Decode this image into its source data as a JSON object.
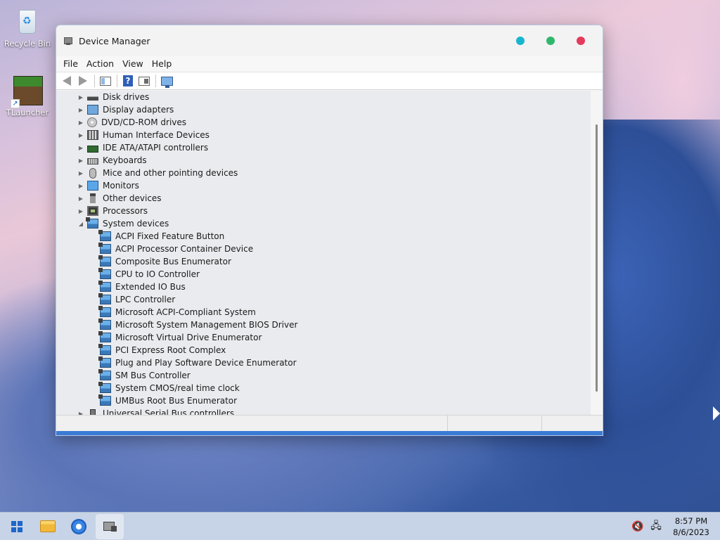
{
  "desktop": {
    "icons": [
      {
        "label": "Recycle Bin",
        "icon": "recycle-bin-icon"
      },
      {
        "label": "TLauncher",
        "icon": "tlauncher-icon"
      }
    ]
  },
  "window": {
    "title": "Device Manager",
    "controls": {
      "minimize_color": "#18b5cf",
      "maximize_color": "#2fb86c",
      "close_color": "#e53a5b"
    },
    "menu": [
      "File",
      "Action",
      "View",
      "Help"
    ],
    "toolbar": [
      "back-arrow-icon",
      "forward-arrow-icon",
      "show-hide-console-tree-icon",
      "help-icon",
      "properties-icon",
      "scan-hardware-icon"
    ],
    "tree": {
      "top_items": [
        {
          "label": "Disk drives",
          "icon": "disk-drive-icon",
          "expanded": false
        },
        {
          "label": "Display adapters",
          "icon": "display-adapter-icon",
          "expanded": false
        },
        {
          "label": "DVD/CD-ROM drives",
          "icon": "dvd-drive-icon",
          "expanded": false
        },
        {
          "label": "Human Interface Devices",
          "icon": "hid-icon",
          "expanded": false
        },
        {
          "label": "IDE ATA/ATAPI controllers",
          "icon": "ide-controller-icon",
          "expanded": false
        },
        {
          "label": "Keyboards",
          "icon": "keyboard-icon",
          "expanded": false
        },
        {
          "label": "Mice and other pointing devices",
          "icon": "mouse-icon",
          "expanded": false
        },
        {
          "label": "Monitors",
          "icon": "monitor-icon",
          "expanded": false
        },
        {
          "label": "Other devices",
          "icon": "other-device-icon",
          "expanded": false
        },
        {
          "label": "Processors",
          "icon": "processor-icon",
          "expanded": false
        },
        {
          "label": "System devices",
          "icon": "system-device-icon",
          "expanded": true
        }
      ],
      "system_devices": [
        "ACPI Fixed Feature Button",
        "ACPI Processor Container Device",
        "Composite Bus Enumerator",
        "CPU to IO Controller",
        "Extended IO Bus",
        "LPC Controller",
        "Microsoft ACPI-Compliant System",
        "Microsoft System Management BIOS Driver",
        "Microsoft Virtual Drive Enumerator",
        "PCI Express Root Complex",
        "Plug and Play Software Device Enumerator",
        "SM Bus Controller",
        "System CMOS/real time clock",
        "UMBus Root Bus Enumerator"
      ],
      "last_item": {
        "label": "Universal Serial Bus controllers",
        "icon": "usb-icon",
        "expanded": false
      }
    }
  },
  "taskbar": {
    "items": [
      "start-icon",
      "file-explorer-icon",
      "browser-icon",
      "device-manager-icon"
    ],
    "tray": {
      "volume": "volume-muted-icon",
      "network": "network-disconnected-icon"
    },
    "clock": {
      "time": "8:57 PM",
      "date": "8/6/2023"
    }
  }
}
